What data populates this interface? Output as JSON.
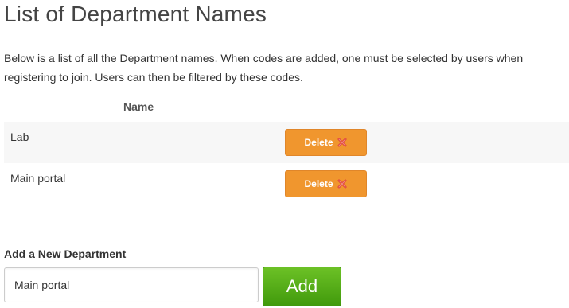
{
  "page": {
    "title": "List of Department Names",
    "description": "Below is a list of all the Department names. When codes are added, one must be selected by users when registering to join. Users can then be filtered by these codes."
  },
  "table": {
    "header_name": "Name",
    "rows": [
      {
        "name": "Lab",
        "delete_label": "Delete",
        "delete_icon": "close-x-icon"
      },
      {
        "name": "Main portal",
        "delete_label": "Delete",
        "delete_icon": "close-x-icon"
      }
    ]
  },
  "add_form": {
    "heading": "Add a New Department",
    "input_value": "Main portal",
    "add_label": "Add"
  },
  "colors": {
    "delete_button": "#f0962e",
    "delete_icon": "#e0443a",
    "add_button": "#4fa81a",
    "row_stripe": "#f7f7f7"
  }
}
